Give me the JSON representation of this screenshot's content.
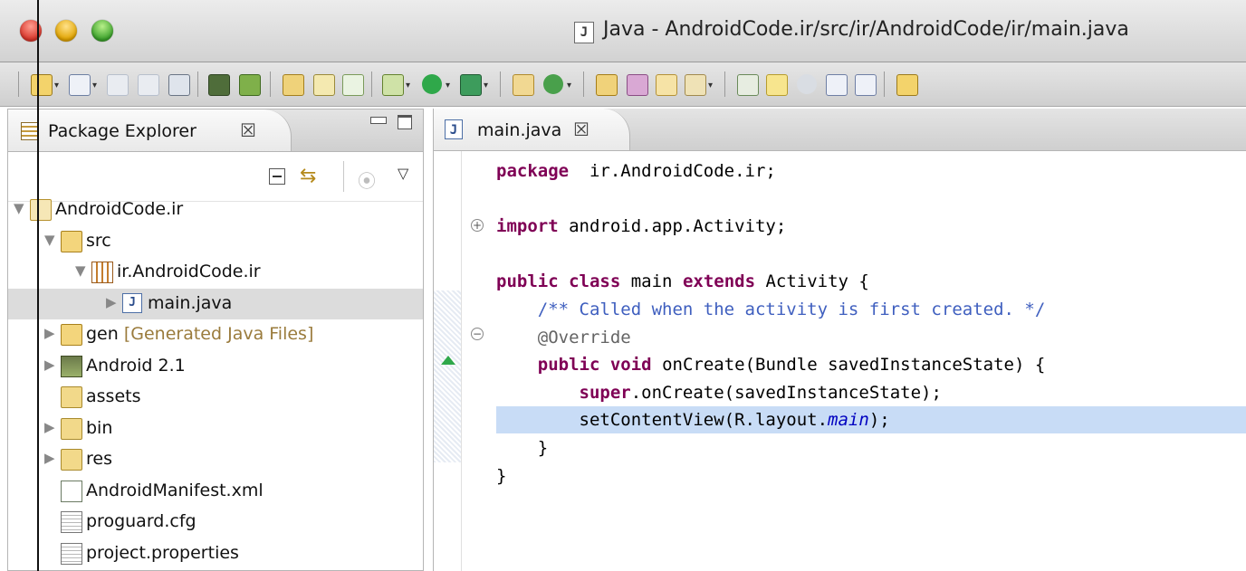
{
  "window": {
    "title": "Java - AndroidCode.ir/src/ir/AndroidCode/ir/main.java",
    "file_icon": "J"
  },
  "package_explorer": {
    "tab_label": "Package Explorer",
    "close_glyph": "☒",
    "tree": [
      {
        "label": "AndroidCode.ir",
        "icon": "project-icon",
        "indent": 0,
        "twisty": "▼"
      },
      {
        "label": "src",
        "icon": "source-folder-icon",
        "indent": 1,
        "twisty": "▼"
      },
      {
        "label": "ir.AndroidCode.ir",
        "icon": "package-icon",
        "indent": 2,
        "twisty": "▼"
      },
      {
        "label": "main.java",
        "icon": "java-file-icon",
        "indent": 3,
        "twisty": "▶",
        "selected": true
      },
      {
        "label": "gen",
        "decoration": "[Generated Java Files]",
        "icon": "source-folder-icon",
        "indent": 1,
        "twisty": "▶"
      },
      {
        "label": "Android 2.1",
        "icon": "library-icon",
        "indent": 1,
        "twisty": "▶"
      },
      {
        "label": "assets",
        "icon": "folder-icon",
        "indent": 1,
        "twisty": ""
      },
      {
        "label": "bin",
        "icon": "folder-icon",
        "indent": 1,
        "twisty": "▶"
      },
      {
        "label": "res",
        "icon": "folder-icon",
        "indent": 1,
        "twisty": "▶"
      },
      {
        "label": "AndroidManifest.xml",
        "icon": "xml-file-icon",
        "indent": 1,
        "twisty": ""
      },
      {
        "label": "proguard.cfg",
        "icon": "text-file-icon",
        "indent": 1,
        "twisty": ""
      },
      {
        "label": "project.properties",
        "icon": "text-file-icon",
        "indent": 1,
        "twisty": ""
      }
    ]
  },
  "editor": {
    "tab_label": "main.java",
    "close_glyph": "☒",
    "lines": [
      [
        [
          "kw",
          "package"
        ],
        [
          "",
          "  ir.AndroidCode.ir;"
        ]
      ],
      [],
      [
        [
          "kw",
          "import"
        ],
        [
          "",
          " android.app.Activity;"
        ]
      ],
      [],
      [
        [
          "kw",
          "public"
        ],
        [
          "",
          " "
        ],
        [
          "kw",
          "class"
        ],
        [
          "",
          " main "
        ],
        [
          "kw",
          "extends"
        ],
        [
          "",
          " Activity {"
        ]
      ],
      [
        [
          "",
          ""
        ],
        [
          "cm",
          "    /** Called when the activity is first created. */"
        ]
      ],
      [
        [
          "an",
          "    @Override"
        ]
      ],
      [
        [
          "",
          "    "
        ],
        [
          "kw",
          "public"
        ],
        [
          "",
          " "
        ],
        [
          "kw",
          "void"
        ],
        [
          "",
          " onCreate(Bundle savedInstanceState) {"
        ]
      ],
      [
        [
          "",
          "        "
        ],
        [
          "kw",
          "super"
        ],
        [
          "",
          ".onCreate(savedInstanceState);"
        ]
      ],
      [
        [
          "",
          "        setContentView(R.layout."
        ],
        [
          "fi",
          "main"
        ],
        [
          "",
          ");"
        ]
      ],
      [
        [
          "",
          "    }"
        ]
      ],
      [
        [
          "",
          "}"
        ]
      ]
    ]
  }
}
